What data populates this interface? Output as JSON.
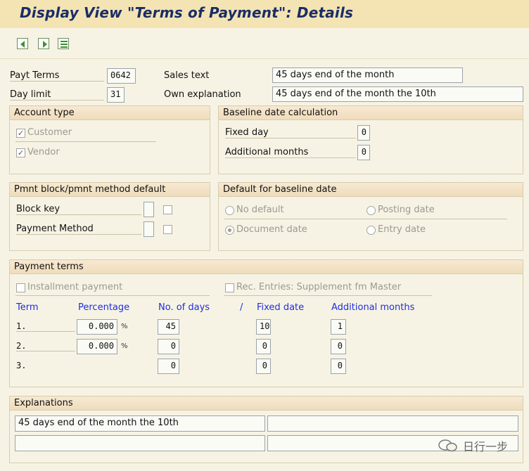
{
  "window": {
    "title": "Display View \"Terms of Payment\": Details"
  },
  "toolbar": {
    "icons": [
      "previous-entry-icon",
      "next-entry-icon",
      "select-entry-icon"
    ]
  },
  "header": {
    "payt_terms_label": "Payt Terms",
    "payt_terms_value": "0642",
    "day_limit_label": "Day limit",
    "day_limit_value": "31",
    "sales_text_label": "Sales text",
    "sales_text_value": "45 days end of the month",
    "own_expl_label": "Own explanation",
    "own_expl_value": "45 days end of the month the 10th"
  },
  "account_type": {
    "title": "Account type",
    "customer_label": "Customer",
    "customer_checked": true,
    "vendor_label": "Vendor",
    "vendor_checked": true
  },
  "baseline_calc": {
    "title": "Baseline date calculation",
    "fixed_day_label": "Fixed day",
    "fixed_day_value": "0",
    "additional_months_label": "Additional months",
    "additional_months_value": "0"
  },
  "pmnt_block": {
    "title": "Pmnt block/pmnt method default",
    "block_key_label": "Block key",
    "payment_method_label": "Payment Method"
  },
  "default_baseline": {
    "title": "Default for baseline date",
    "no_default": "No default",
    "posting_date": "Posting date",
    "document_date": "Document date",
    "entry_date": "Entry date",
    "selected": "Document date"
  },
  "payment_terms": {
    "title": "Payment terms",
    "installment_label": "Installment payment",
    "rec_entries_label": "Rec. Entries: Supplement fm Master",
    "columns": {
      "term": "Term",
      "percentage": "Percentage",
      "no_of_days": "No. of days",
      "slash": "/",
      "fixed_date": "Fixed date",
      "additional_months": "Additional months"
    },
    "percent_suffix": "%",
    "rows": [
      {
        "term": "1.",
        "percentage": "0.000",
        "days": "45",
        "fixed_date": "10",
        "add_months": "1"
      },
      {
        "term": "2.",
        "percentage": "0.000",
        "days": "0",
        "fixed_date": "0",
        "add_months": "0"
      },
      {
        "term": "3.",
        "percentage": "",
        "days": "0",
        "fixed_date": "0",
        "add_months": "0"
      }
    ]
  },
  "explanations": {
    "title": "Explanations",
    "line1": "45 days end of the month the 10th",
    "line2": "",
    "line3": "",
    "line4": ""
  },
  "watermark": {
    "text": "日行一步"
  }
}
